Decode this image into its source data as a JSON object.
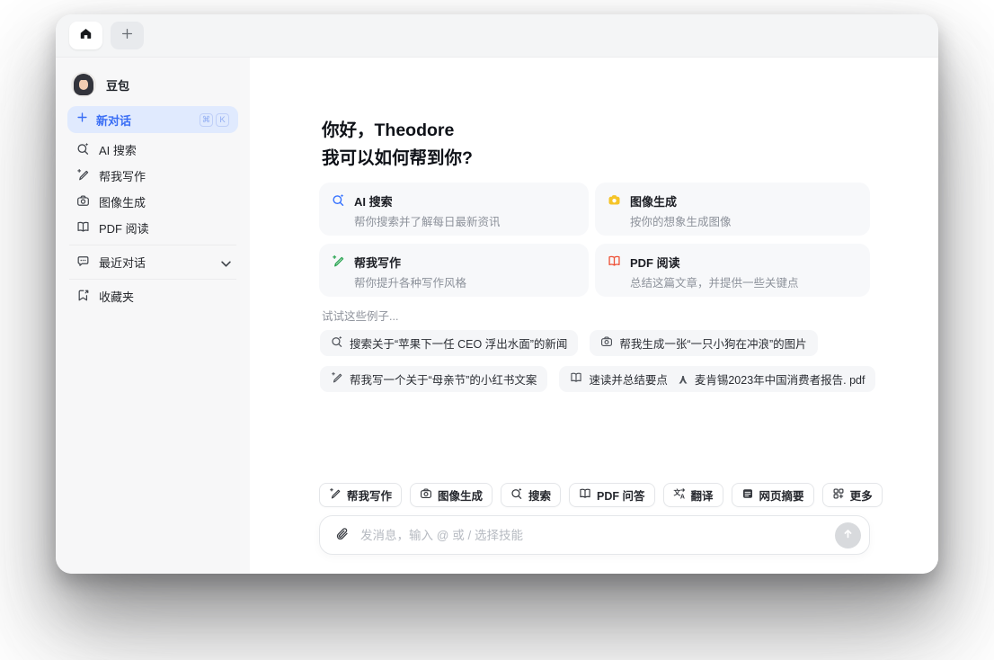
{
  "colors": {
    "accent_blue": "#3370ff",
    "image_yellow": "#f5c428",
    "write_green": "#2aa552",
    "pdf_red": "#ee5238",
    "adobe_pdf_red": "#e8432c",
    "new_chat_bg": "#e0eafe"
  },
  "tabbar": {
    "new_tab_label": "+"
  },
  "sidebar": {
    "profile_name": "豆包",
    "new_chat": {
      "label": "新对话",
      "shortcut": [
        "⌘",
        "K"
      ]
    },
    "items": [
      {
        "label": "AI 搜索"
      },
      {
        "label": "帮我写作"
      },
      {
        "label": "图像生成"
      },
      {
        "label": "PDF 阅读"
      }
    ],
    "recent_label": "最近对话",
    "favorites_label": "收藏夹"
  },
  "main": {
    "greeting_line1": "你好，Theodore",
    "greeting_line2": "我可以如何帮到你?",
    "cards": [
      {
        "title": "AI 搜索",
        "desc": "帮你搜索并了解每日最新资讯"
      },
      {
        "title": "图像生成",
        "desc": "按你的想象生成图像"
      },
      {
        "title": "帮我写作",
        "desc": "帮你提升各种写作风格"
      },
      {
        "title": "PDF 阅读",
        "desc": "总结这篇文章，并提供一些关键点"
      }
    ],
    "examples_label": "试试这些例子...",
    "examples": [
      {
        "text": "搜索关于“苹果下一任 CEO 浮出水面”的新闻"
      },
      {
        "text": "帮我生成一张“一只小狗在冲浪”的图片"
      },
      {
        "text": "帮我写一个关于“母亲节”的小红书文案"
      },
      {
        "text": "速读并总结要点",
        "file": "麦肯锡2023年中国消费者报告. pdf"
      }
    ],
    "skills": [
      {
        "label": "帮我写作"
      },
      {
        "label": "图像生成"
      },
      {
        "label": "搜索"
      },
      {
        "label": "PDF 问答"
      },
      {
        "label": "翻译"
      },
      {
        "label": "网页摘要"
      },
      {
        "label": "更多"
      }
    ],
    "composer_placeholder": "发消息，输入 @ 或 / 选择技能"
  }
}
